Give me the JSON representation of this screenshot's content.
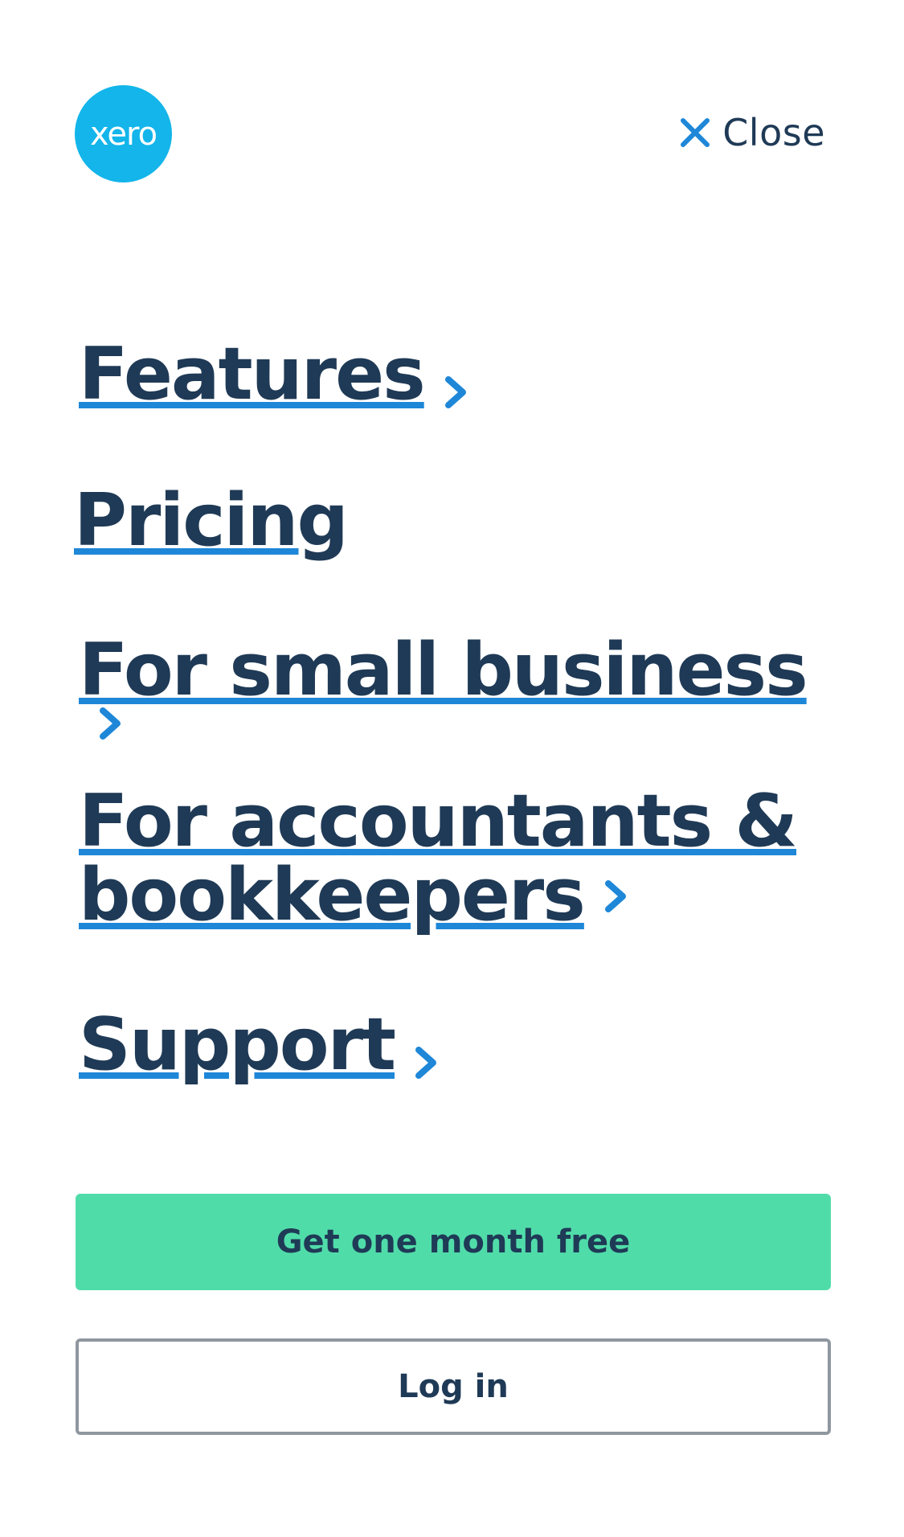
{
  "logo": {
    "text": "xero"
  },
  "close": {
    "label": "Close"
  },
  "nav": {
    "items": [
      {
        "label": "Features",
        "has_chevron": true
      },
      {
        "label": "Pricing",
        "has_chevron": false
      },
      {
        "label": "For small business",
        "has_chevron": true
      },
      {
        "label_line1": "For accountants &",
        "label_line2": "bookkeepers",
        "has_chevron": true
      },
      {
        "label": "Support",
        "has_chevron": true
      }
    ]
  },
  "actions": {
    "primary_label": "Get one month free",
    "secondary_label": "Log in"
  },
  "colors": {
    "brand": "#13b5ea",
    "text": "#1f3a56",
    "link_accent": "#1e87d8",
    "primary_button": "#50dca9",
    "secondary_border": "#8f979f"
  },
  "icons": {
    "close": "close-icon",
    "chevron": "chevron-right-icon"
  }
}
